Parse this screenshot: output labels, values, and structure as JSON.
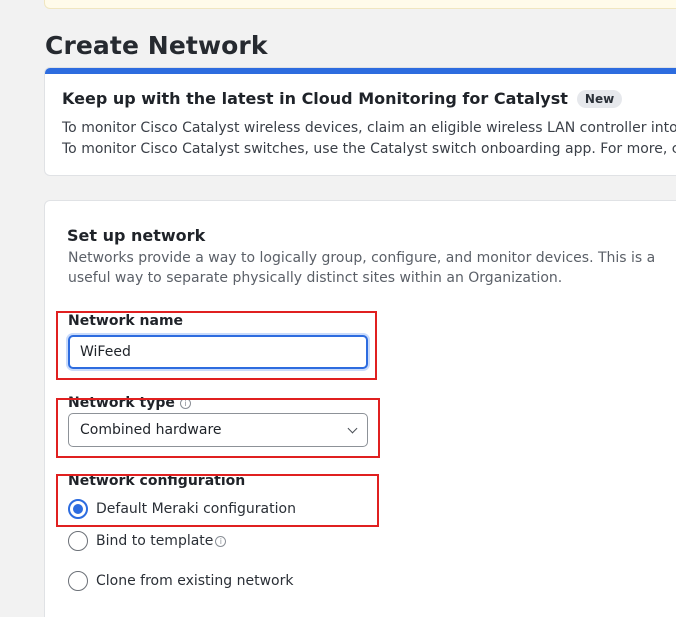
{
  "page": {
    "title": "Create Network"
  },
  "promo": {
    "heading": "Keep up with the latest in Cloud Monitoring for Catalyst",
    "badge": "New",
    "line1": "To monitor Cisco Catalyst wireless devices, claim an eligible wireless LAN controller into your",
    "line2": "To monitor Cisco Catalyst switches, use the Catalyst switch onboarding app. For more, check"
  },
  "setup": {
    "title": "Set up network",
    "description": "Networks provide a way to logically group, configure, and monitor devices. This is a useful way to separate physically distinct sites within an Organization.",
    "name_label": "Network name",
    "name_value": "WiFeed",
    "type_label": "Network type",
    "type_selected": "Combined hardware",
    "config_label": "Network configuration",
    "options": [
      {
        "label": "Default Meraki configuration",
        "checked": true
      },
      {
        "label": "Bind to template",
        "checked": false
      },
      {
        "label": "Clone from existing network",
        "checked": false
      }
    ]
  },
  "colors": {
    "accent": "#2d6cdf",
    "highlight": "#e02020"
  }
}
